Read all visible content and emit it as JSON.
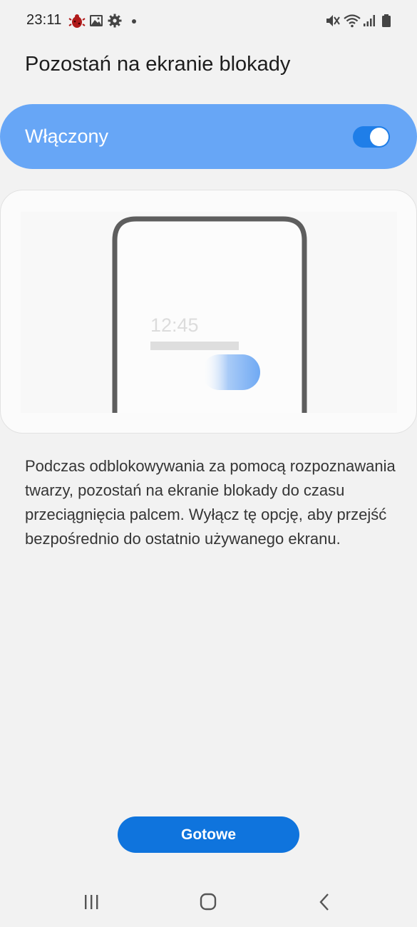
{
  "status_bar": {
    "time": "23:11",
    "left_icons": [
      "bug-icon",
      "image-icon",
      "gear-icon",
      "dot-icon"
    ],
    "right_icons": [
      "mute-icon",
      "wifi-icon",
      "signal-icon",
      "battery-icon"
    ]
  },
  "page": {
    "title": "Pozostań na ekranie blokady"
  },
  "toggle": {
    "label": "Włączony",
    "state": "on"
  },
  "illustration": {
    "clock_text": "12:45"
  },
  "description": "Podczas odblokowywania za pomocą rozpoznawania twarzy, pozostań na ekranie blokady do czasu przeciągnięcia palcem. Wyłącz tę opcję, aby przejść bezpośrednio do ostatnio używanego ekranu.",
  "done_button": {
    "label": "Gotowe"
  },
  "nav_bar": {
    "buttons": [
      "recent-apps",
      "home",
      "back"
    ]
  },
  "colors": {
    "background": "#f2f2f2",
    "toggle_card": "#67a6f6",
    "switch_track": "#1f7ee8",
    "primary_button": "#0f74dd"
  }
}
